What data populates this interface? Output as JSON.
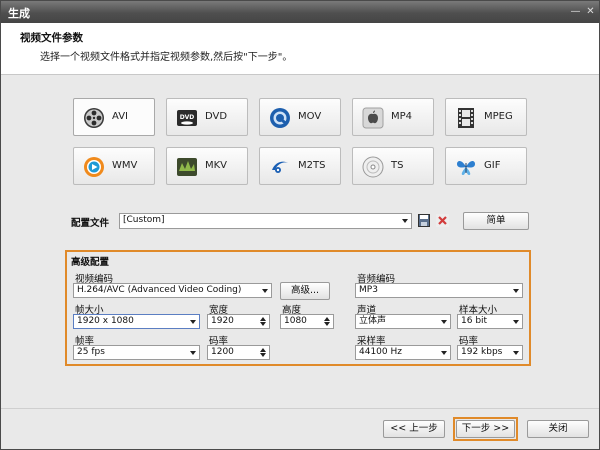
{
  "window": {
    "title": "生成"
  },
  "header": {
    "title": "视频文件参数",
    "subtitle": "选择一个视频文件格式并指定视频参数,然后按\"下一步\"。"
  },
  "formats": [
    {
      "label": "AVI",
      "icon": "avi-film-reel-icon",
      "selected": true
    },
    {
      "label": "DVD",
      "icon": "dvd-icon"
    },
    {
      "label": "MOV",
      "icon": "quicktime-icon"
    },
    {
      "label": "MP4",
      "icon": "apple-icon"
    },
    {
      "label": "MPEG",
      "icon": "film-strip-icon"
    },
    {
      "label": "WMV",
      "icon": "windows-media-icon"
    },
    {
      "label": "MKV",
      "icon": "mkv-icon"
    },
    {
      "label": "M2TS",
      "icon": "bluray-icon"
    },
    {
      "label": "TS",
      "icon": "disc-icon"
    },
    {
      "label": "GIF",
      "icon": "butterfly-icon"
    }
  ],
  "profile": {
    "label": "配置文件",
    "value": "[Custom]",
    "simple_button": "简单"
  },
  "advanced": {
    "title": "高级配置",
    "video_codec_label": "视频编码",
    "video_codec_value": "H.264/AVC (Advanced Video Coding)",
    "advanced_button": "高级...",
    "audio_codec_label": "音频编码",
    "audio_codec_value": "MP3",
    "frame_size_label": "帧大小",
    "frame_size_value": "1920 x 1080",
    "width_label": "宽度",
    "width_value": "1920",
    "height_label": "高度",
    "height_value": "1080",
    "channels_label": "声道",
    "channels_value": "立体声",
    "sample_size_label": "样本大小",
    "sample_size_value": "16 bit",
    "frame_rate_label": "帧率",
    "frame_rate_value": "25 fps",
    "bitrate_label": "码率",
    "bitrate_value": "1200",
    "sample_rate_label": "采样率",
    "sample_rate_value": "44100 Hz",
    "audio_bitrate_label": "码率",
    "audio_bitrate_value": "192 kbps"
  },
  "footer": {
    "back": "<< 上一步",
    "next": "下一步 >>",
    "close": "关闭"
  },
  "colors": {
    "highlight": "#e08a2a",
    "titlebar": "#555555"
  }
}
